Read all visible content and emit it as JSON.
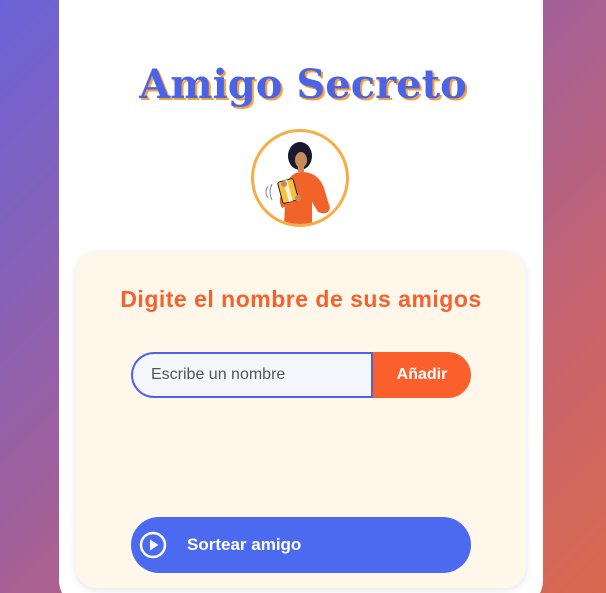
{
  "header": {
    "title": "Amigo Secreto"
  },
  "colors": {
    "brand_blue": "#4b63e6",
    "accent_orange": "#fb5f2b",
    "title_shadow": "#f6a13a",
    "panel_bg": "#fff7ea"
  },
  "avatar": {
    "icon": "person-with-gift-illustration"
  },
  "form": {
    "prompt": "Digite el nombre de sus amigos",
    "name_input": {
      "value": "",
      "placeholder": "Escribe un nombre"
    },
    "add_label": "Añadir"
  },
  "friends_list": [],
  "result": [],
  "draw_button": {
    "label": "Sortear amigo",
    "icon": "play-circle-icon"
  }
}
